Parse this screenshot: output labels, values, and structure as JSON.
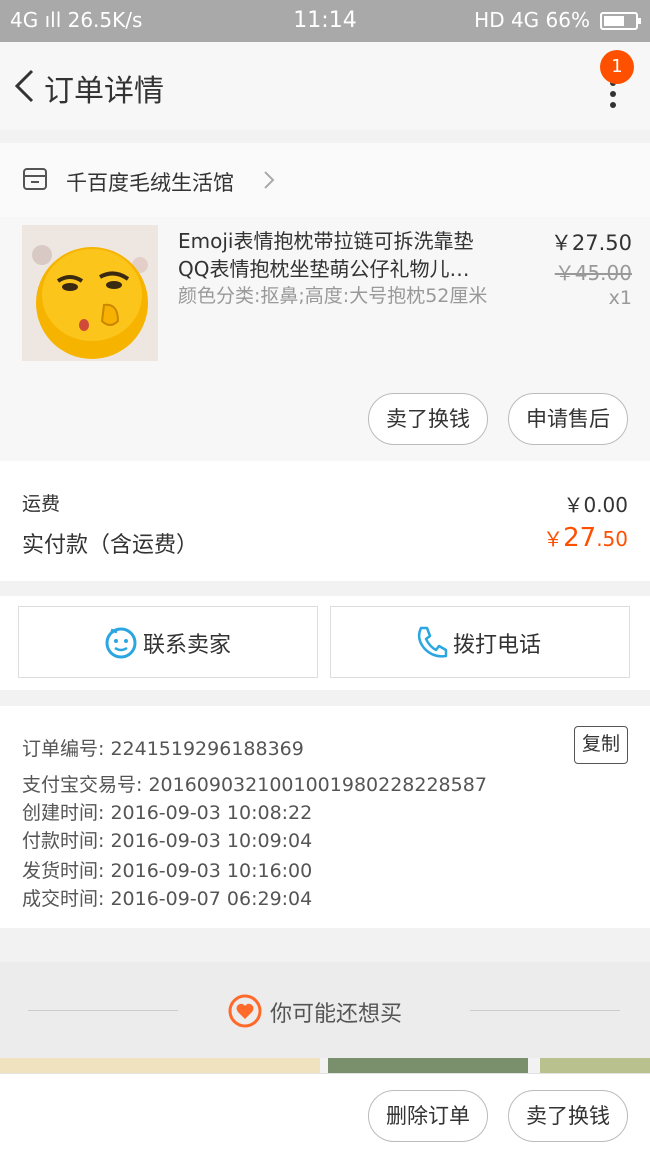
{
  "status_bar": {
    "left": "4G ıll  26.5K/s",
    "time": "11:14",
    "right": "HD 4G  66%"
  },
  "nav": {
    "title": "订单详情",
    "badge_count": "1"
  },
  "shop": {
    "name": "千百度毛绒生活馆"
  },
  "item": {
    "title_line1": "Emoji表情抱枕带拉链可拆洗靠垫",
    "title_line2": "QQ表情抱枕坐垫萌公仔礼物儿…",
    "sku": "颜色分类:抠鼻;高度:大号抱枕52厘米",
    "price": "￥27.50",
    "original_price": "￥45.00",
    "quantity": "x1",
    "button_sell": "卖了换钱",
    "button_after_sale": "申请售后"
  },
  "fees": {
    "shipping_label": "运费",
    "shipping_value": "￥0.00",
    "total_label": "实付款（含运费）",
    "total_currency": "￥",
    "total_integer": "27",
    "total_decimal": ".50"
  },
  "contact": {
    "chat_label": "联系卖家",
    "call_label": "拨打电话"
  },
  "order_info": {
    "order_no": "订单编号: 2241519296188369",
    "alipay_no": "支付宝交易号: 2016090321001001980228228587",
    "created": "创建时间: 2016-09-03 10:08:22",
    "paid": "付款时间: 2016-09-03 10:09:04",
    "shipped": "发货时间: 2016-09-03 10:16:00",
    "completed": "成交时间: 2016-09-07 06:29:04",
    "copy_label": "复制"
  },
  "recommend": {
    "title": "你可能还想买"
  },
  "bottom_bar": {
    "delete_label": "删除订单",
    "sell_label": "卖了换钱"
  },
  "colors": {
    "accent": "#ff5000",
    "chat_icon": "#2ba6e1"
  }
}
